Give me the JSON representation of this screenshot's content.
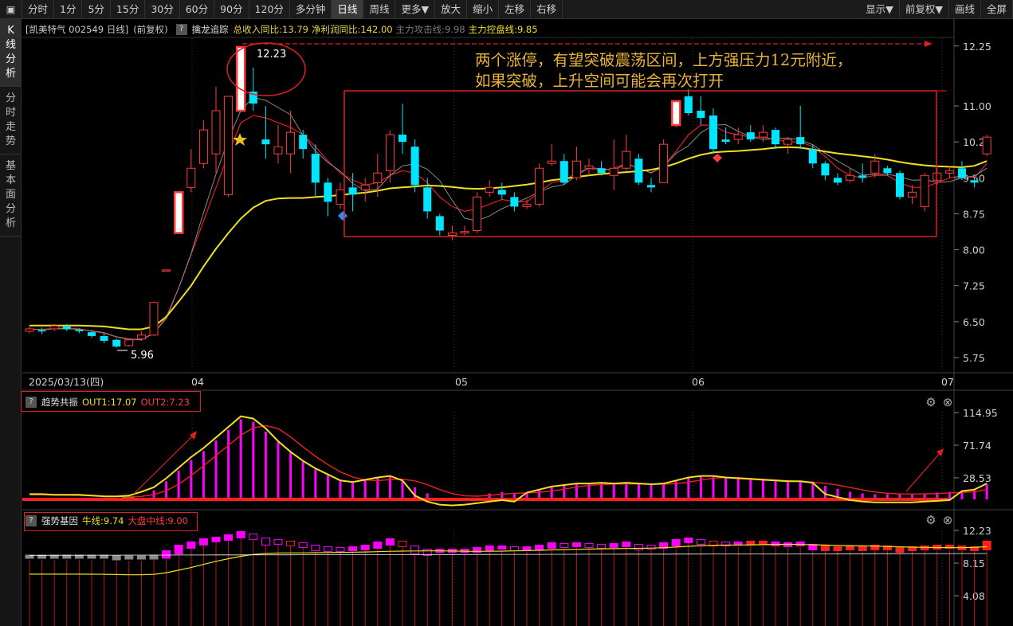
{
  "toolbar": {
    "periods": [
      "分时",
      "1分",
      "5分",
      "15分",
      "30分",
      "60分",
      "90分",
      "120分",
      "多分钟",
      "日线",
      "周线",
      "更多▼",
      "放大",
      "缩小",
      "左移",
      "右移"
    ],
    "active_period": "日线",
    "right_buttons": [
      "显示▼",
      "前复权▼",
      "画线",
      "全屏"
    ]
  },
  "sidebar": {
    "tabs": [
      "K\n线\n分\n析",
      "分\n时\n走\n势",
      "基\n本\n面\n分\n析"
    ]
  },
  "main_panel": {
    "title": "[凯美特气 002549 日线]",
    "adjust": "(前复权)",
    "indicator_name": "擒龙追踪",
    "items": [
      {
        "label": "总收入同比:13.79",
        "color": "#e8d44a"
      },
      {
        "label": "净利润同比:142.00",
        "color": "#e8d44a"
      },
      {
        "label": "主力攻击线:9.98",
        "color": "#7a7a7a"
      },
      {
        "label": "主力控盘线:9.85",
        "color": "#f0e020"
      }
    ],
    "y_ticks": [
      "12.25",
      "11.00",
      "10.25",
      "9.50",
      "8.75",
      "8.00",
      "7.25",
      "6.50",
      "5.75"
    ],
    "x_labels": [
      "2025/03/13(四)",
      "04",
      "05",
      "06",
      "07"
    ],
    "high_label": "12.23",
    "low_label": "5.96",
    "annotation": [
      "两个涨停，有望突破震荡区间，上方强压力12元附近，",
      "如果突破，上升空间可能会再次打开"
    ]
  },
  "panel2": {
    "name": "趋势共振",
    "out1": "OUT1:17.07",
    "out2": "OUT2:7.23",
    "y_ticks": [
      "114.95",
      "71.74",
      "28.53"
    ]
  },
  "panel3": {
    "name": "强势基因",
    "line1": "牛线:9.74",
    "line2": "大盘中线:9.00",
    "y_ticks": [
      "12.23",
      "8.15",
      "4.08"
    ]
  },
  "colors": {
    "up": "#ff3c3c",
    "down": "#00e5ff",
    "ma_yellow": "#f0e020",
    "ma_red": "#e02020",
    "ma_gray": "#8a8a8a",
    "magenta": "#ff00ff",
    "annotation": "#e8b23a",
    "box": "#e02020"
  },
  "chart_data": {
    "type": "candlestick",
    "candles": [
      [
        6.3,
        6.35,
        6.25,
        6.4
      ],
      [
        6.32,
        6.3,
        6.24,
        6.38
      ],
      [
        6.35,
        6.41,
        6.3,
        6.45
      ],
      [
        6.4,
        6.34,
        6.3,
        6.45
      ],
      [
        6.33,
        6.3,
        6.26,
        6.36
      ],
      [
        6.28,
        6.2,
        6.16,
        6.31
      ],
      [
        6.2,
        6.1,
        6.05,
        6.25
      ],
      [
        6.12,
        5.98,
        5.96,
        6.15
      ],
      [
        6.0,
        6.12,
        5.98,
        6.15
      ],
      [
        6.14,
        6.22,
        6.1,
        6.3
      ],
      [
        6.22,
        6.9,
        6.2,
        6.92
      ],
      [
        7.58,
        7.58,
        7.58,
        7.58
      ],
      [
        8.35,
        9.2,
        8.35,
        9.2
      ],
      [
        9.3,
        9.7,
        9.2,
        10.1
      ],
      [
        9.8,
        10.5,
        9.7,
        10.7
      ],
      [
        10.0,
        10.9,
        9.6,
        11.4
      ],
      [
        9.15,
        11.2,
        9.1,
        11.2
      ],
      [
        10.9,
        12.23,
        10.9,
        12.23
      ],
      [
        11.3,
        11.05,
        10.9,
        11.8
      ],
      [
        10.3,
        10.2,
        9.9,
        11.0
      ],
      [
        10.0,
        10.15,
        9.8,
        10.6
      ],
      [
        10.0,
        10.45,
        9.6,
        10.9
      ],
      [
        10.4,
        10.1,
        9.9,
        10.5
      ],
      [
        10.0,
        9.4,
        9.1,
        10.2
      ],
      [
        9.4,
        9.0,
        8.7,
        9.5
      ],
      [
        8.95,
        9.25,
        8.85,
        9.4
      ],
      [
        9.3,
        9.15,
        8.8,
        9.6
      ],
      [
        9.25,
        9.35,
        9.0,
        9.5
      ],
      [
        9.4,
        9.6,
        9.1,
        10.0
      ],
      [
        9.65,
        10.4,
        9.4,
        10.5
      ],
      [
        10.4,
        10.25,
        10.0,
        11.05
      ],
      [
        10.15,
        9.35,
        9.2,
        10.3
      ],
      [
        9.3,
        8.8,
        8.65,
        9.5
      ],
      [
        8.7,
        8.4,
        8.3,
        8.75
      ],
      [
        8.3,
        8.35,
        8.2,
        8.5
      ],
      [
        8.35,
        8.38,
        8.3,
        8.5
      ],
      [
        8.4,
        9.1,
        8.35,
        9.2
      ],
      [
        9.2,
        9.3,
        9.1,
        9.45
      ],
      [
        9.25,
        9.15,
        9.05,
        9.4
      ],
      [
        9.1,
        8.9,
        8.8,
        9.2
      ],
      [
        8.9,
        8.95,
        8.85,
        9.05
      ],
      [
        8.95,
        9.7,
        8.9,
        9.8
      ],
      [
        9.8,
        9.85,
        9.75,
        10.2
      ],
      [
        9.85,
        9.4,
        9.35,
        10.0
      ],
      [
        9.5,
        9.85,
        9.45,
        10.15
      ],
      [
        9.7,
        9.75,
        9.55,
        9.9
      ],
      [
        9.7,
        9.6,
        9.55,
        9.85
      ],
      [
        9.55,
        9.7,
        9.25,
        10.3
      ],
      [
        9.7,
        10.05,
        9.65,
        10.4
      ],
      [
        9.9,
        9.4,
        9.35,
        10.0
      ],
      [
        9.35,
        9.3,
        9.2,
        9.5
      ],
      [
        9.4,
        10.2,
        9.4,
        10.3
      ],
      [
        10.6,
        11.1,
        10.55,
        11.1
      ],
      [
        11.2,
        10.85,
        10.8,
        11.35
      ],
      [
        10.9,
        10.75,
        10.6,
        11.2
      ],
      [
        10.8,
        10.1,
        10.0,
        10.95
      ],
      [
        10.3,
        10.25,
        10.2,
        10.55
      ],
      [
        10.3,
        10.4,
        10.2,
        10.55
      ],
      [
        10.45,
        10.3,
        10.25,
        10.6
      ],
      [
        10.35,
        10.45,
        10.25,
        10.6
      ],
      [
        10.5,
        10.2,
        10.1,
        10.55
      ],
      [
        10.2,
        10.3,
        10.0,
        10.35
      ],
      [
        10.35,
        10.2,
        10.1,
        11.0
      ],
      [
        10.1,
        9.8,
        9.7,
        10.2
      ],
      [
        9.8,
        9.55,
        9.45,
        9.85
      ],
      [
        9.5,
        9.4,
        9.35,
        9.6
      ],
      [
        9.45,
        9.55,
        9.4,
        9.7
      ],
      [
        9.55,
        9.5,
        9.4,
        9.8
      ],
      [
        9.6,
        9.85,
        9.5,
        10.0
      ],
      [
        9.7,
        9.6,
        9.55,
        9.75
      ],
      [
        9.6,
        9.1,
        9.05,
        9.65
      ],
      [
        9.1,
        9.2,
        8.95,
        9.35
      ],
      [
        8.9,
        9.55,
        8.8,
        9.6
      ],
      [
        9.45,
        9.6,
        9.35,
        9.7
      ],
      [
        9.6,
        9.65,
        9.5,
        9.75
      ],
      [
        9.7,
        9.5,
        9.45,
        9.85
      ],
      [
        9.45,
        9.4,
        9.3,
        9.5
      ],
      [
        10.0,
        10.35,
        9.95,
        10.4
      ]
    ],
    "ma_yellow": [
      6.42,
      6.42,
      6.42,
      6.42,
      6.42,
      6.41,
      6.4,
      6.37,
      6.34,
      6.34,
      6.4,
      6.6,
      6.92,
      7.25,
      7.65,
      8.02,
      8.35,
      8.65,
      8.88,
      9.02,
      9.07,
      9.08,
      9.08,
      9.1,
      9.12,
      9.14,
      9.17,
      9.19,
      9.23,
      9.28,
      9.3,
      9.32,
      9.34,
      9.33,
      9.31,
      9.28,
      9.27,
      9.28,
      9.3,
      9.33,
      9.36,
      9.4,
      9.45,
      9.48,
      9.52,
      9.55,
      9.58,
      9.6,
      9.62,
      9.64,
      9.67,
      9.72,
      9.8,
      9.9,
      9.98,
      10.03,
      10.05,
      10.06,
      10.08,
      10.1,
      10.13,
      10.14,
      10.13,
      10.09,
      10.05,
      10.01,
      9.98,
      9.95,
      9.92,
      9.88,
      9.83,
      9.79,
      9.76,
      9.74,
      9.73,
      9.72,
      9.75,
      9.85
    ],
    "ma_red": [
      6.34,
      6.34,
      6.36,
      6.37,
      6.35,
      6.3,
      6.26,
      6.18,
      6.12,
      6.12,
      6.25,
      6.6,
      7.2,
      7.9,
      8.6,
      9.3,
      10.0,
      10.65,
      10.8,
      10.75,
      10.65,
      10.55,
      10.4,
      10.15,
      9.85,
      9.6,
      9.45,
      9.35,
      9.4,
      9.55,
      9.65,
      9.6,
      9.4,
      9.1,
      8.9,
      8.8,
      8.85,
      8.95,
      9.05,
      9.0,
      9.0,
      9.2,
      9.4,
      9.45,
      9.6,
      9.7,
      9.65,
      9.7,
      9.8,
      9.7,
      9.6,
      9.75,
      10.05,
      10.4,
      10.6,
      10.6,
      10.45,
      10.4,
      10.35,
      10.35,
      10.3,
      10.25,
      10.25,
      10.15,
      9.95,
      9.7,
      9.55,
      9.5,
      9.55,
      9.55,
      9.4,
      9.3,
      9.3,
      9.4,
      9.5,
      9.55,
      9.5,
      9.8
    ],
    "osc_bars": [
      6,
      6,
      5,
      5,
      5,
      4,
      3,
      3,
      4,
      6,
      12,
      24,
      38,
      52,
      64,
      78,
      92,
      106,
      103,
      90,
      76,
      62,
      50,
      40,
      32,
      24,
      22,
      25,
      28,
      30,
      24,
      16,
      8,
      4,
      3,
      4,
      6,
      8,
      10,
      8,
      8,
      12,
      16,
      18,
      20,
      20,
      21,
      20,
      21,
      20,
      19,
      20,
      24,
      28,
      30,
      30,
      28,
      27,
      26,
      25,
      24,
      23,
      23,
      21,
      18,
      14,
      10,
      8,
      7,
      7,
      7,
      7,
      8,
      9,
      10,
      10,
      12,
      20
    ],
    "gene_boxes": [
      9.15,
      9.15,
      9.15,
      9.15,
      9.15,
      9.15,
      9.15,
      9.05,
      9.05,
      9.05,
      9.15,
      9.7,
      10.4,
      10.8,
      11.2,
      11.4,
      11.7,
      12.1,
      11.8,
      11.3,
      11.1,
      10.9,
      10.7,
      10.4,
      10.2,
      10.1,
      10.2,
      10.4,
      10.8,
      11.2,
      10.9,
      10.3,
      9.9,
      9.9,
      9.9,
      9.9,
      10.1,
      10.3,
      10.3,
      10.2,
      10.2,
      10.4,
      10.7,
      10.6,
      10.7,
      10.6,
      10.5,
      10.6,
      10.8,
      10.5,
      10.4,
      10.7,
      11.1,
      11.3,
      11.1,
      10.9,
      10.8,
      10.8,
      10.9,
      10.9,
      10.8,
      10.7,
      10.8,
      10.5,
      10.3,
      10.2,
      10.3,
      10.2,
      10.4,
      10.3,
      10.1,
      10.2,
      10.3,
      10.4,
      10.4,
      10.3,
      10.2,
      10.9
    ]
  }
}
